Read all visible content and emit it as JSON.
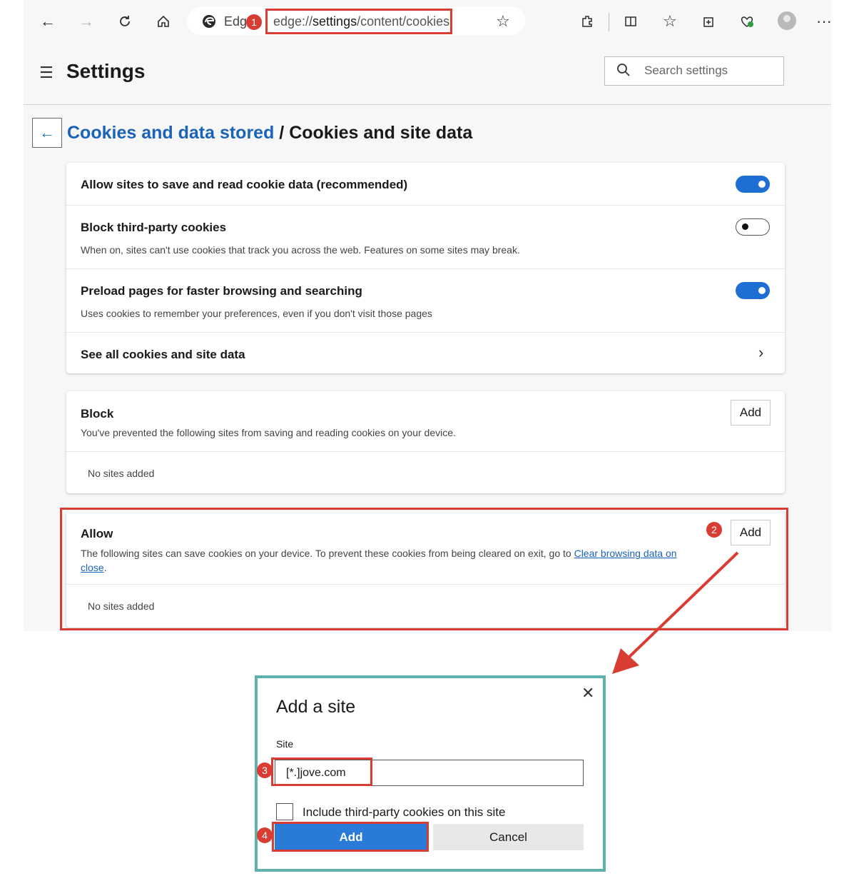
{
  "browser": {
    "tab_label": "Edge",
    "url_prefix": "edge://",
    "url_bold": "settings",
    "url_suffix": "/content/cookies",
    "icons": [
      "back-arrow-icon",
      "forward-arrow-icon",
      "refresh-icon",
      "home-icon",
      "edge-logo-icon",
      "star-icon",
      "extensions-icon",
      "split-screen-icon",
      "favorites-icon",
      "collections-icon",
      "health-icon",
      "profile-avatar",
      "more-icon"
    ]
  },
  "settings": {
    "title": "Settings",
    "search_placeholder": "Search settings"
  },
  "breadcrumb": {
    "parent": "Cookies and data stored",
    "separator": " / ",
    "current": "Cookies and site data"
  },
  "main_card": {
    "rows": [
      {
        "title": "Allow sites to save and read cookie data (recommended)",
        "state": "on"
      },
      {
        "title": "Block third-party cookies",
        "subtitle": "When on, sites can't use cookies that track you across the web. Features on some sites may break.",
        "state": "off"
      },
      {
        "title": "Preload pages for faster browsing and searching",
        "subtitle": "Uses cookies to remember your preferences, even if you don't visit those pages",
        "state": "on"
      },
      {
        "title": "See all cookies and site data"
      }
    ]
  },
  "block_card": {
    "title": "Block",
    "subtitle": "You've prevented the following sites from saving and reading cookies on your device.",
    "add_label": "Add",
    "empty": "No sites added"
  },
  "allow_card": {
    "title": "Allow",
    "subtitle_before": "The following sites can save cookies on your device. To prevent these cookies from being cleared on exit, go to ",
    "link_part1": "Clear browsing data on",
    "link_part2": "close",
    "subtitle_after": ".",
    "add_label": "Add",
    "empty": "No sites added"
  },
  "dialog": {
    "title": "Add a site",
    "site_label": "Site",
    "site_value": "[*.]jove.com",
    "checkbox_label": "Include third-party cookies on this site",
    "checkbox_checked": false,
    "add_label": "Add",
    "cancel_label": "Cancel"
  },
  "badges": [
    "1",
    "2",
    "3",
    "4"
  ],
  "colors": {
    "annotation": "#d93c32",
    "accent": "#1f6ed4",
    "dialog_border": "#5fb1ae",
    "link": "#1a63b8"
  }
}
